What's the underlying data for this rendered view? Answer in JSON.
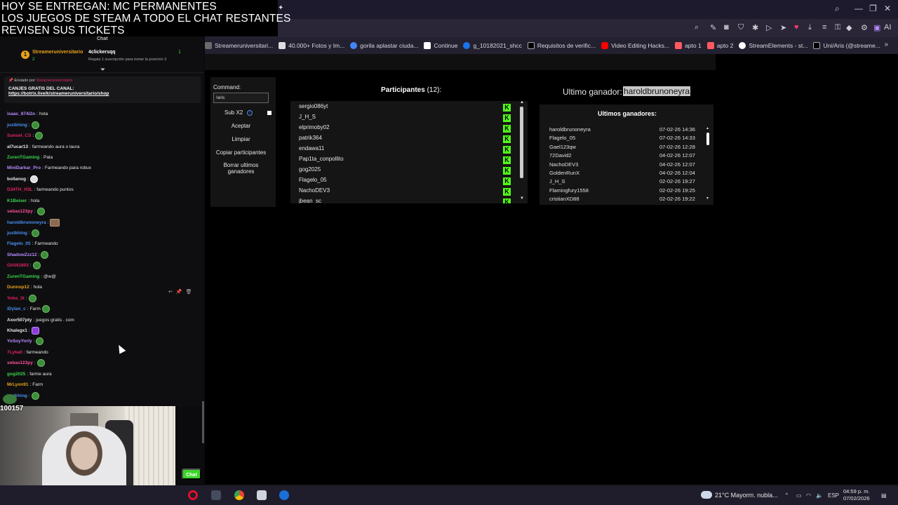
{
  "overlay": {
    "lines": [
      "HOY SE ENTREGAN: MC PERMANENTES",
      "LOS JUEGOS DE STEAM A TODO EL CHAT RESTANTES",
      "REVISEN SUS TICKETS"
    ]
  },
  "browser": {
    "bookmarks": [
      {
        "label": "Streameruniversitari...",
        "color": "#6a6a6a"
      },
      {
        "label": "40.000+ Fotos y Im...",
        "color": "#dddddd"
      },
      {
        "label": "gorila aplastar ciuda...",
        "color": "#4285f4"
      },
      {
        "label": "Continue",
        "color": "#ffffff"
      },
      {
        "label": "g_10182021_shcc",
        "color": "#1a73e8"
      },
      {
        "label": "Requisitos de verific...",
        "color": "#000000"
      },
      {
        "label": "Video Editing Hacks...",
        "color": "#ff0000"
      },
      {
        "label": "apto 1",
        "color": "#ff5a5f"
      },
      {
        "label": "apto 2",
        "color": "#ff5a5f"
      },
      {
        "label": "StreamElements - st...",
        "color": "#ffffff"
      },
      {
        "label": "Uni/Aris (@streame...",
        "color": "#000000"
      }
    ],
    "more": "»",
    "ai_label": "AI"
  },
  "chat": {
    "title": "Chat",
    "top_sub": {
      "rank": "1",
      "user": "Streameruniversitario",
      "count": "2",
      "user2": "4clickersqq",
      "rule": "Regala 1 suscripción para tomar la posición 3",
      "count2": "1"
    },
    "pinned": {
      "sent_by": "Enviado por",
      "pinner": "Streameruniversitario",
      "title": "CANJES GRATIS DEL CANAL:",
      "link": "https://botrix.live/k/streameruniversitario/shop"
    },
    "messages": [
      {
        "user": "isaac_874i2o",
        "color": "#b88bff",
        "text": "hola",
        "emote": ""
      },
      {
        "user": "justkhing",
        "color": "#4a8ef0",
        "text": "",
        "emote": "green"
      },
      {
        "user": "Sunset_CS",
        "color": "#e0245e",
        "text": "",
        "emote": "green"
      },
      {
        "user": "al7ucar13",
        "color": "#e6e6e6",
        "text": "farmeando aura o laura",
        "emote": ""
      },
      {
        "user": "ZurenTGaming",
        "color": "#3ad34a",
        "text": "Pala",
        "emote": ""
      },
      {
        "user": "MiniDarkar_Pro",
        "color": "#b88bff",
        "text": "Farmeando para robux",
        "emote": ""
      },
      {
        "user": "bollanog",
        "color": "#e6e6e6",
        "text": "",
        "emote": "ghost"
      },
      {
        "user": "D34TH_H3L",
        "color": "#e0245e",
        "text": "farmeando puntos",
        "emote": ""
      },
      {
        "user": "K1Beiser",
        "color": "#3ad34a",
        "text": "hola",
        "emote": ""
      },
      {
        "user": "sebas123py",
        "color": "#ff4f9a",
        "text": "",
        "emote": "green"
      },
      {
        "user": "haroldbrunoneyra",
        "color": "#4a8ef0",
        "text": "",
        "emote": "cat"
      },
      {
        "user": "justkhing",
        "color": "#4a8ef0",
        "text": "",
        "emote": "green"
      },
      {
        "user": "Flagelo_05",
        "color": "#4a8ef0",
        "text": "Farmeando",
        "emote": ""
      },
      {
        "user": "ShadowZzz12",
        "color": "#b88bff",
        "text": "",
        "emote": "green"
      },
      {
        "user": "GIAN1803",
        "color": "#e0245e",
        "text": "",
        "emote": "green"
      },
      {
        "user": "ZurenTGaming",
        "color": "#3ad34a",
        "text": "@w@",
        "emote": ""
      },
      {
        "user": "Dunnop12",
        "color": "#e8a21a",
        "text": "hola",
        "emote": ""
      },
      {
        "user": "Yoko_3t",
        "color": "#e0245e",
        "text": "",
        "emote": "green"
      },
      {
        "user": "iDylan_c",
        "color": "#4a8ef0",
        "text": "Farm",
        "emote": "green"
      },
      {
        "user": "Axor507pty",
        "color": "#e6e6e6",
        "text": "juegos gratis . com",
        "emote": ""
      },
      {
        "user": "Khalegx1",
        "color": "#e6e6e6",
        "text": "",
        "emote": "purple"
      },
      {
        "user": "YoSoyYorly",
        "color": "#b88bff",
        "text": "",
        "emote": "green"
      },
      {
        "user": "7Lyka0",
        "color": "#e0245e",
        "text": "farmeando",
        "emote": ""
      },
      {
        "user": "sebas123py",
        "color": "#ff4f9a",
        "text": "",
        "emote": "green"
      },
      {
        "user": "gog2025",
        "color": "#3ad34a",
        "text": "farme aura",
        "emote": ""
      },
      {
        "user": "MrLyon91",
        "color": "#e8a21a",
        "text": "Farm",
        "emote": ""
      },
      {
        "user": "justkhing",
        "color": "#4a8ef0",
        "text": "",
        "emote": "green"
      }
    ],
    "chat_button": "Chat"
  },
  "webcam": {
    "viewers": "100157"
  },
  "app": {
    "command_label": "Command:",
    "command_value": "!aris",
    "sub_x2": "Sub X2",
    "buttons": [
      "Aceptar",
      "Limpiar",
      "Copiar participantes",
      "Borrar ultimos ganadores"
    ],
    "participants_title": "Participantes",
    "participants_count": "(12):",
    "participants": [
      "sergio086yt",
      "J_H_S",
      "elprimoby02",
      "patrik364",
      "endawa11",
      "Pap1ta_conpollito",
      "gog2025",
      "Flagelo_05",
      "NachoDEV3",
      "jbean_sc"
    ],
    "kick_letter": "K",
    "last_winner_label": "Ultimo ganador:",
    "last_winner": "haroldbrunoneyra",
    "winners_title": "Ultimos ganadores:",
    "winners": [
      {
        "name": "haroldbrunoneyra",
        "date": "07-02-26 14:36"
      },
      {
        "name": "Flagelo_05",
        "date": "07-02-26 14:33"
      },
      {
        "name": "Gael123qw",
        "date": "07-02-26 12:28"
      },
      {
        "name": "72David2",
        "date": "04-02-26 12:07"
      },
      {
        "name": "NachoDEV3",
        "date": "04-02-26 12:07"
      },
      {
        "name": "GoldenRunX",
        "date": "04-02-26 12:04"
      },
      {
        "name": "J_H_S",
        "date": "02-02-26 19:27"
      },
      {
        "name": "Flamingfury1558",
        "date": "02-02-26 19:25"
      },
      {
        "name": "cristianXD88",
        "date": "02-02-26 19:22"
      }
    ]
  },
  "taskbar": {
    "weather": "21°C  Mayorm. nubla...",
    "lang": "ESP",
    "time": "04:59 p. m.",
    "date": "07/02/2026"
  }
}
